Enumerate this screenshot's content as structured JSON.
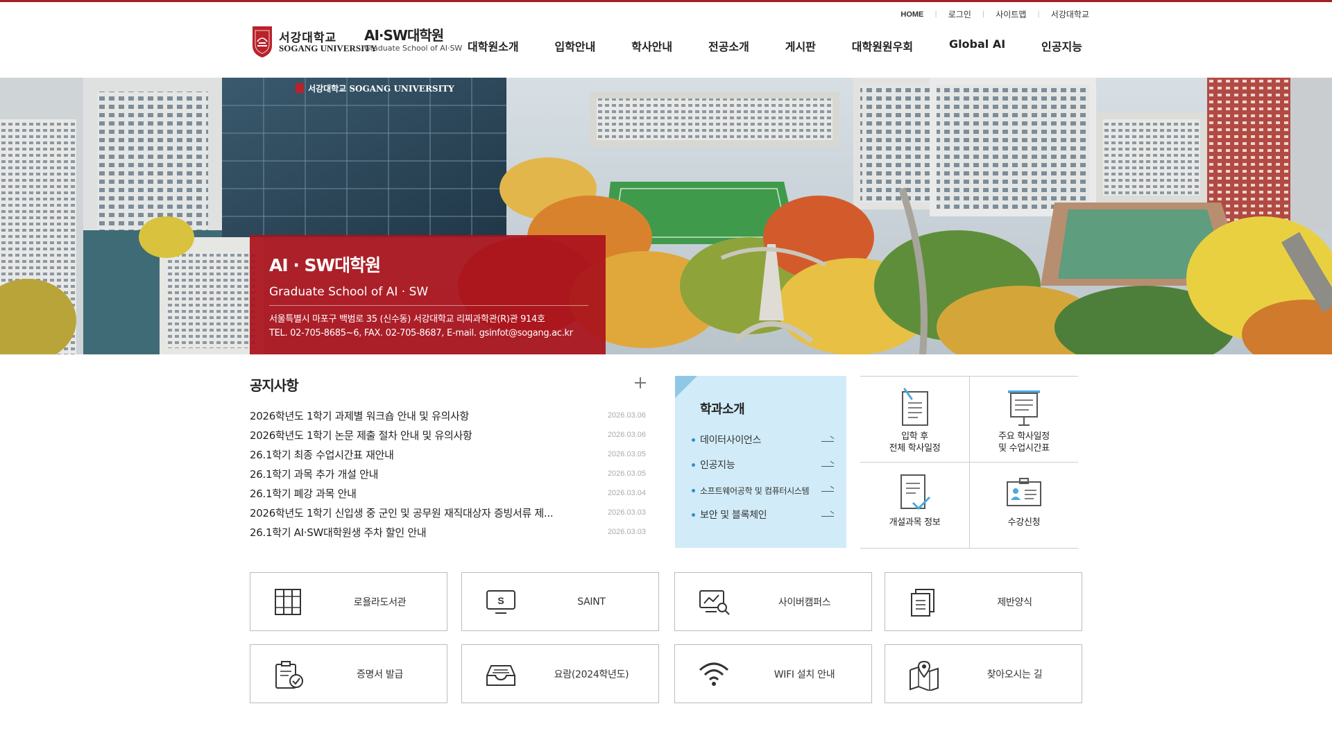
{
  "utility": {
    "home": "HOME",
    "login": "로그인",
    "sitemap": "사이트맵",
    "sogang": "서강대학교"
  },
  "logo": {
    "university_kor": "서강대학교",
    "university_eng": "SOGANG UNIVERSITY",
    "school_kor": "AI·SW대학원",
    "school_eng": "Graduate School of AI·SW"
  },
  "nav": [
    "대학원소개",
    "입학안내",
    "학사안내",
    "전공소개",
    "게시판",
    "대학원원우회",
    "Global AI",
    "인공지능"
  ],
  "hero": {
    "campus_sign": "서강대학교 SOGANG UNIVERSITY",
    "title": "AI · SW대학원",
    "subtitle": "Graduate School of AI · SW",
    "address": "서울특별시 마포구 백범로 35 (신수동) 서강대학교 리찌과학관(R)관 914호",
    "contact": "TEL. 02-705-8685~6, FAX. 02-705-8687, E-mail. gsinfot@sogang.ac.kr"
  },
  "notice": {
    "title": "공지사항",
    "items": [
      {
        "title": "2026학년도 1학기 과제별 워크숍 안내 및 유의사항",
        "date": "2026.03.06"
      },
      {
        "title": "2026학년도 1학기 논문 제출 절차 안내 및 유의사항",
        "date": "2026.03.06"
      },
      {
        "title": "26.1학기 최종 수업시간표 재안내",
        "date": "2026.03.05"
      },
      {
        "title": "26.1학기 과목 추가 개설 안내",
        "date": "2026.03.05"
      },
      {
        "title": "26.1학기 폐강 과목 안내",
        "date": "2026.03.04"
      },
      {
        "title": "2026학년도 1학기 신입생 중 군인 및 공무원 재직대상자 증빙서류 제...",
        "date": "2026.03.03"
      },
      {
        "title": "26.1학기 AI·SW대학원생 주차 할인 안내",
        "date": "2026.03.03"
      }
    ]
  },
  "dept": {
    "title": "학과소개",
    "items": [
      "데이터사이언스",
      "인공지능",
      "소프트웨어공학 및 컴퓨터시스템",
      "보안 및 블록체인"
    ]
  },
  "quick": {
    "schedule_after": [
      "입학 후",
      "전체 학사일정"
    ],
    "major_schedule": [
      "주요 학사일정",
      "및 수업시간표"
    ],
    "courses": "개설과목 정보",
    "registration": "수강신청"
  },
  "links": [
    {
      "label": "로욜라도서관",
      "icon": "library-icon"
    },
    {
      "label": "SAINT",
      "icon": "monitor-s-icon",
      "icon_letter": "S"
    },
    {
      "label": "사이버캠퍼스",
      "icon": "cyber-campus-icon"
    },
    {
      "label": "제반양식",
      "icon": "forms-icon"
    },
    {
      "label": "증명서 발급",
      "icon": "certificate-icon"
    },
    {
      "label": "요람(2024학년도)",
      "icon": "inbox-tray-icon"
    },
    {
      "label": "WIFI 설치 안내",
      "icon": "wifi-icon"
    },
    {
      "label": "찾아오시는 길",
      "icon": "map-pin-icon"
    }
  ],
  "colors": {
    "brand_red": "#a31d24",
    "dept_bg": "#d1ecf8",
    "dept_bullet": "#2f8fd0"
  }
}
